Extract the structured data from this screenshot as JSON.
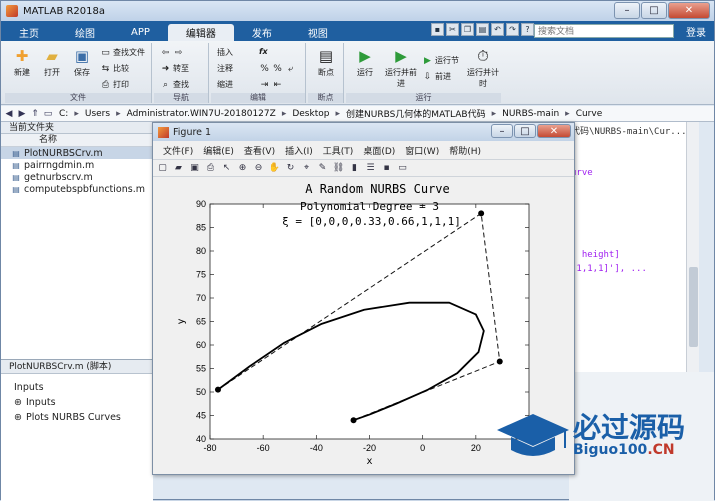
{
  "window": {
    "title": "MATLAB R2018a"
  },
  "tabs": [
    {
      "label": "主页"
    },
    {
      "label": "绘图"
    },
    {
      "label": "APP"
    },
    {
      "label": "编辑器"
    },
    {
      "label": "发布"
    },
    {
      "label": "视图"
    }
  ],
  "search": {
    "placeholder": "搜索文档"
  },
  "login": "登录",
  "ribbon": {
    "file": {
      "new": "新建",
      "open": "打开",
      "save": "保存",
      "find_files": "查找文件",
      "compare": "比较",
      "print": "打印",
      "group": "文件"
    },
    "nav": {
      "goto": "转至",
      "find": "查找",
      "group": "导航"
    },
    "edit": {
      "insert": "插入",
      "fx": "fx",
      "comment": "注释",
      "indent": "缩进",
      "group": "编辑"
    },
    "breakpoints": {
      "label": "断点",
      "group": "断点"
    },
    "run": {
      "run": "运行",
      "run_advance": "运行并前进",
      "run_section": "运行节",
      "advance": "前进",
      "run_time": "运行并计时",
      "group": "运行"
    }
  },
  "address": {
    "crumbs": [
      "C:",
      "Users",
      "Administrator.WIN7U-20180127Z",
      "Desktop",
      "创建NURBS几何体的MATLAB代码",
      "NURBS-main",
      "Curve"
    ]
  },
  "current_folder": {
    "title": "当前文件夹",
    "column": "名称",
    "files": [
      {
        "name": "PlotNURBSCrv.m"
      },
      {
        "name": "pairrngdmin.m"
      },
      {
        "name": "getnurbscrv.m"
      },
      {
        "name": "computebspbfunctions.m"
      }
    ]
  },
  "details": {
    "title": "PlotNURBSCrv.m  (脚本)",
    "section": "Inputs",
    "items": [
      {
        "label": "Inputs"
      },
      {
        "label": "Plots NURBS Curves"
      }
    ]
  },
  "editor": {
    "path_tail": "代码\\NURBS-main\\Cur...",
    "line1": "urve",
    "line2": ", height]",
    "line3": ",1,1,1]'], ..."
  },
  "figure": {
    "title": "Figure 1",
    "menu": [
      "文件(F)",
      "编辑(E)",
      "查看(V)",
      "插入(I)",
      "工具(T)",
      "桌面(D)",
      "窗口(W)",
      "帮助(H)"
    ]
  },
  "chart_data": {
    "type": "line",
    "title": "A Random NURBS Curve",
    "subtitle": "Polynomial Degree = 3",
    "knot_label": "ξ = [0,0,0,0.33,0.66,1,1,1]",
    "xlabel": "x",
    "ylabel": "y",
    "xlim": [
      -80,
      40
    ],
    "ylim": [
      40,
      90
    ],
    "xticks": [
      -80,
      -60,
      -40,
      -20,
      0,
      20
    ],
    "yticks": [
      40,
      45,
      50,
      55,
      60,
      65,
      70,
      75,
      80,
      85,
      90
    ],
    "control_points": [
      [
        -77,
        50.5
      ],
      [
        22,
        88
      ],
      [
        29,
        56.5
      ],
      [
        -26,
        44
      ]
    ],
    "curve": [
      [
        -77,
        50.5
      ],
      [
        -65,
        55.5
      ],
      [
        -52,
        60.5
      ],
      [
        -38,
        64.5
      ],
      [
        -22,
        67.5
      ],
      [
        -5,
        69
      ],
      [
        10,
        69
      ],
      [
        20,
        66.5
      ],
      [
        23,
        63
      ],
      [
        21,
        58.5
      ],
      [
        13,
        54
      ],
      [
        2,
        50.5
      ],
      [
        -10,
        47.5
      ],
      [
        -20,
        45.2
      ],
      [
        -26,
        44
      ]
    ]
  },
  "watermark": {
    "line1": "必过源码",
    "line2": "Biguo100",
    "line2_suffix": ".CN"
  }
}
